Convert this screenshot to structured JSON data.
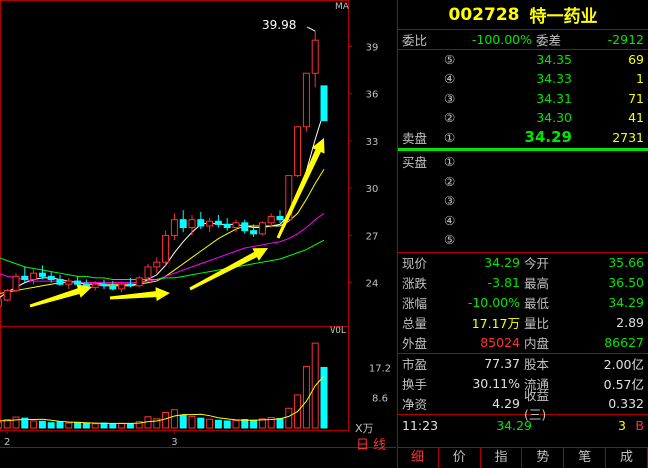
{
  "stock": {
    "code": "002728",
    "name": "特一药业"
  },
  "chart_labels": {
    "ma": "MA",
    "vol": "VOL",
    "xwan": "X万",
    "period": "日线",
    "high_marker": "39.98"
  },
  "price_axis": [
    "39",
    "36",
    "33",
    "30",
    "27",
    "24"
  ],
  "vol_axis": [
    "17.2",
    "8.6"
  ],
  "date_ticks": [
    "2",
    "3"
  ],
  "weibi": {
    "label": "委比",
    "value": "-100.00%",
    "label2": "委差",
    "value2": "-2912"
  },
  "sell_book": [
    {
      "num": "⑤",
      "price": "34.35",
      "vol": "69"
    },
    {
      "num": "④",
      "price": "34.33",
      "vol": "1"
    },
    {
      "num": "③",
      "price": "34.31",
      "vol": "71"
    },
    {
      "num": "②",
      "price": "34.30",
      "vol": "41"
    },
    {
      "num": "①",
      "price": "34.29",
      "vol": "2731",
      "label": "卖盘"
    }
  ],
  "buy_book": [
    {
      "num": "①",
      "label": "买盘"
    },
    {
      "num": "②"
    },
    {
      "num": "③"
    },
    {
      "num": "④"
    },
    {
      "num": "⑤"
    }
  ],
  "stats": [
    {
      "l1": "现价",
      "v1": "34.29",
      "c1": "green",
      "l2": "今开",
      "v2": "35.66",
      "c2": "green"
    },
    {
      "l1": "涨跌",
      "v1": "-3.81",
      "c1": "green",
      "l2": "最高",
      "v2": "36.50",
      "c2": "green"
    },
    {
      "l1": "涨幅",
      "v1": "-10.00%",
      "c1": "green",
      "l2": "最低",
      "v2": "34.29",
      "c2": "green"
    },
    {
      "l1": "总量",
      "v1": "17.17万",
      "c1": "yellow",
      "l2": "量比",
      "v2": "2.89",
      "c2": "white"
    },
    {
      "l1": "外盘",
      "v1": "85024",
      "c1": "red",
      "l2": "内盘",
      "v2": "86627",
      "c2": "green"
    }
  ],
  "fundamentals": [
    {
      "l1": "市盈",
      "v1": "77.37",
      "l2": "股本",
      "v2": "2.00亿"
    },
    {
      "l1": "换手",
      "v1": "30.11%",
      "l2": "流通",
      "v2": "0.57亿"
    },
    {
      "l1": "净资",
      "v1": "4.29",
      "l2": "收益(三)",
      "v2": "0.332"
    }
  ],
  "tick": {
    "time": "11:23",
    "price": "34.29",
    "vol": "3",
    "dir": "B"
  },
  "tabs": [
    "细",
    "价",
    "指",
    "势",
    "笔",
    "成"
  ],
  "colors": {
    "up": "#ff3030",
    "down": "#00ffff",
    "ma5": "#ffffff",
    "ma10": "#ffff00",
    "ma20": "#ff00ff",
    "ma60": "#00ff00",
    "arrow": "#ffff00"
  },
  "chart_data": {
    "type": "candlestick",
    "price_range": [
      21.5,
      41
    ],
    "vol_range": [
      0,
      25
    ],
    "candles": [
      [
        22.6,
        22.9,
        22.3,
        22.5,
        2.1
      ],
      [
        22.5,
        23.0,
        22.4,
        22.9,
        1.6
      ],
      [
        22.9,
        23.6,
        22.8,
        23.5,
        2.4
      ],
      [
        23.5,
        24.6,
        23.4,
        24.4,
        3.1
      ],
      [
        24.4,
        25.0,
        24.0,
        24.2,
        2.8
      ],
      [
        24.2,
        24.8,
        23.9,
        24.6,
        2.0
      ],
      [
        24.6,
        25.1,
        24.2,
        24.4,
        1.9
      ],
      [
        24.4,
        24.7,
        24.0,
        24.2,
        1.5
      ],
      [
        24.2,
        24.5,
        23.8,
        23.9,
        1.7
      ],
      [
        23.9,
        24.3,
        23.6,
        24.1,
        1.4
      ],
      [
        24.1,
        24.4,
        23.8,
        23.9,
        1.6
      ],
      [
        23.9,
        24.2,
        23.5,
        23.7,
        1.3
      ],
      [
        23.7,
        24.1,
        23.5,
        23.9,
        1.2
      ],
      [
        23.9,
        24.2,
        23.6,
        23.8,
        1.4
      ],
      [
        23.8,
        24.1,
        23.5,
        23.6,
        1.1
      ],
      [
        23.6,
        24.0,
        23.4,
        23.9,
        1.3
      ],
      [
        23.9,
        24.3,
        23.7,
        23.8,
        1.2
      ],
      [
        23.8,
        24.4,
        23.7,
        24.3,
        1.8
      ],
      [
        24.3,
        25.2,
        24.1,
        25.0,
        3.2
      ],
      [
        25.0,
        25.6,
        24.6,
        25.3,
        2.6
      ],
      [
        25.3,
        27.3,
        25.1,
        27.0,
        4.4
      ],
      [
        27.0,
        28.4,
        26.7,
        28.0,
        5.2
      ],
      [
        28.0,
        28.6,
        27.2,
        27.5,
        3.6
      ],
      [
        27.5,
        28.3,
        27.0,
        28.0,
        3.3
      ],
      [
        28.0,
        28.5,
        27.4,
        27.6,
        2.8
      ],
      [
        27.6,
        28.1,
        27.2,
        27.9,
        2.5
      ],
      [
        27.9,
        28.3,
        27.5,
        27.7,
        2.2
      ],
      [
        27.7,
        28.1,
        27.3,
        27.5,
        2.0
      ],
      [
        27.5,
        28.0,
        27.2,
        27.8,
        2.1
      ],
      [
        27.8,
        28.0,
        27.1,
        27.3,
        2.4
      ],
      [
        27.3,
        27.7,
        26.9,
        27.1,
        2.2
      ],
      [
        27.1,
        27.9,
        27.0,
        27.8,
        2.6
      ],
      [
        27.8,
        28.4,
        27.5,
        28.2,
        3.0
      ],
      [
        28.2,
        28.6,
        27.8,
        28.0,
        2.7
      ],
      [
        28.0,
        30.8,
        27.9,
        30.8,
        5.6
      ],
      [
        30.8,
        33.9,
        30.7,
        33.9,
        9.4
      ],
      [
        33.9,
        37.3,
        33.6,
        37.3,
        17.5
      ],
      [
        37.3,
        39.98,
        36.4,
        39.4,
        24.1
      ],
      [
        36.5,
        36.5,
        34.29,
        34.29,
        17.2
      ]
    ],
    "ma": {
      "ma5": [
        22.7,
        23.0,
        23.4,
        23.7,
        24.0,
        24.2,
        24.3,
        24.3,
        24.2,
        24.1,
        24.0,
        23.9,
        23.9,
        23.8,
        23.8,
        23.8,
        23.8,
        23.9,
        24.2,
        24.5,
        25.1,
        25.9,
        26.6,
        27.2,
        27.7,
        27.8,
        27.7,
        27.7,
        27.7,
        27.6,
        27.5,
        27.5,
        27.6,
        27.7,
        28.3,
        29.4,
        31.1,
        33.1,
        34.9
      ],
      "ma10": [
        23.2,
        23.3,
        23.4,
        23.5,
        23.6,
        23.7,
        23.8,
        23.9,
        24.0,
        24.0,
        24.0,
        24.0,
        24.0,
        23.9,
        23.9,
        23.9,
        23.9,
        23.9,
        24.0,
        24.1,
        24.4,
        24.8,
        25.2,
        25.6,
        26.0,
        26.4,
        26.8,
        27.1,
        27.4,
        27.6,
        27.6,
        27.6,
        27.6,
        27.6,
        27.9,
        28.4,
        29.3,
        30.3,
        31.2
      ],
      "ma20": [
        24.8,
        24.6,
        24.4,
        24.3,
        24.2,
        24.1,
        24.1,
        24.1,
        24.1,
        24.0,
        24.0,
        24.0,
        24.0,
        24.0,
        24.0,
        24.0,
        24.0,
        24.0,
        24.1,
        24.2,
        24.4,
        24.6,
        24.8,
        25.0,
        25.2,
        25.4,
        25.6,
        25.8,
        26.0,
        26.2,
        26.3,
        26.4,
        26.5,
        26.6,
        26.8,
        27.1,
        27.5,
        28.0,
        28.4
      ],
      "ma60": [
        25.8,
        25.6,
        25.4,
        25.2,
        25.0,
        24.9,
        24.8,
        24.7,
        24.6,
        24.5,
        24.4,
        24.4,
        24.3,
        24.3,
        24.2,
        24.2,
        24.2,
        24.2,
        24.2,
        24.2,
        24.3,
        24.3,
        24.4,
        24.5,
        24.6,
        24.7,
        24.8,
        24.9,
        25.0,
        25.1,
        25.2,
        25.3,
        25.4,
        25.5,
        25.7,
        25.9,
        26.1,
        26.4,
        26.7
      ]
    },
    "vol_ma": {
      "ma5": [
        2.0,
        2.0,
        2.1,
        2.3,
        2.4,
        2.4,
        2.5,
        2.2,
        1.9,
        1.7,
        1.6,
        1.5,
        1.4,
        1.3,
        1.3,
        1.3,
        1.3,
        1.4,
        1.8,
        2.0,
        2.6,
        3.4,
        3.8,
        3.8,
        3.9,
        3.5,
        2.9,
        2.6,
        2.3,
        2.2,
        2.2,
        2.3,
        2.4,
        2.6,
        3.3,
        4.7,
        7.6,
        12.0,
        14.8
      ]
    }
  }
}
